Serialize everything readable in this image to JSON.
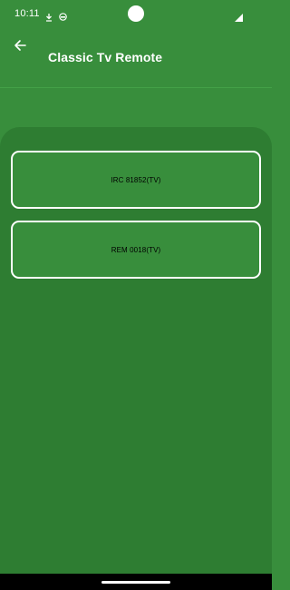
{
  "status_bar": {
    "time": "10:11",
    "icons": [
      "download-icon",
      "face-icon",
      "camera-cutout",
      "signal-icon"
    ]
  },
  "app_bar": {
    "back_icon": "arrow-back-icon",
    "title": "Classic Tv Remote"
  },
  "remotes": [
    {
      "label": "IRC 81852(TV)"
    },
    {
      "label": "REM 0018(TV)"
    }
  ],
  "colors": {
    "app_background": "#388e3c",
    "panel_background": "#2e7d32",
    "card_border": "#ffffff",
    "card_text": "#000000",
    "nav_bar": "#000000"
  }
}
